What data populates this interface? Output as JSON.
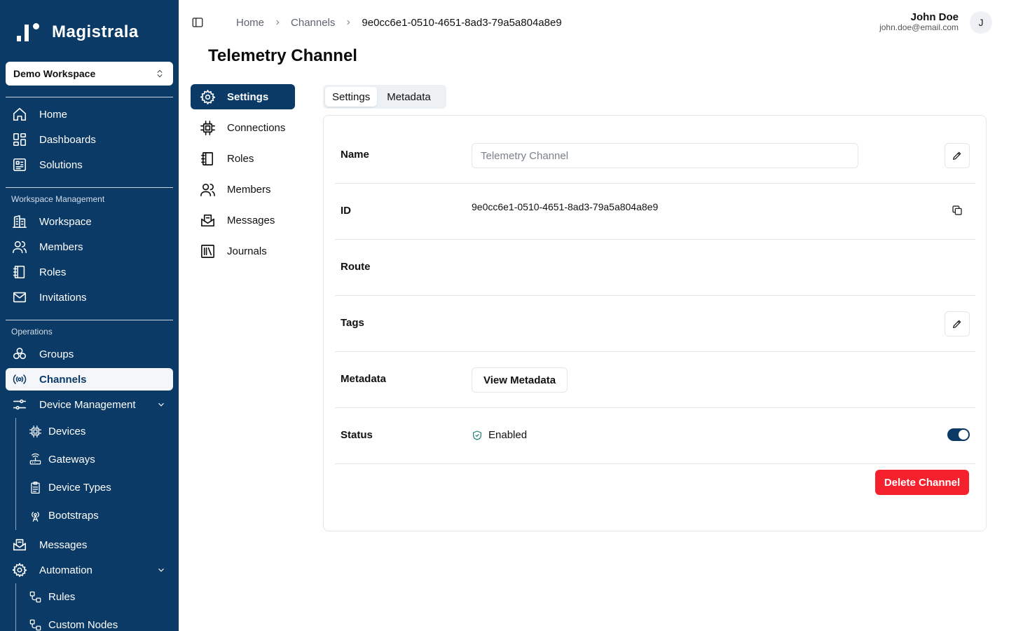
{
  "app": {
    "name": "Magistrala"
  },
  "workspace_select": {
    "value": "Demo Workspace"
  },
  "sidebar": {
    "top_items": [
      {
        "label": "Home",
        "icon": "home-icon"
      },
      {
        "label": "Dashboards",
        "icon": "dashboard-icon"
      },
      {
        "label": "Solutions",
        "icon": "solutions-icon"
      }
    ],
    "section_workspace": "Workspace Management",
    "workspace_items": [
      {
        "label": "Workspace",
        "icon": "building-icon"
      },
      {
        "label": "Members",
        "icon": "users-icon"
      },
      {
        "label": "Roles",
        "icon": "notebook-icon"
      },
      {
        "label": "Invitations",
        "icon": "mail-icon"
      }
    ],
    "section_operations": "Operations",
    "operations_items": [
      {
        "label": "Groups",
        "icon": "groups-icon"
      },
      {
        "label": "Channels",
        "icon": "broadcast-icon",
        "active": true
      },
      {
        "label": "Device Management",
        "icon": "sliders-icon"
      }
    ],
    "device_sub_items": [
      {
        "label": "Devices",
        "icon": "chip-icon"
      },
      {
        "label": "Gateways",
        "icon": "router-icon"
      },
      {
        "label": "Device Types",
        "icon": "clipboard-icon"
      },
      {
        "label": "Bootstraps",
        "icon": "antenna-icon"
      }
    ],
    "messages_item": {
      "label": "Messages",
      "icon": "mail-open-icon"
    },
    "automation_item": {
      "label": "Automation",
      "icon": "gear-icon"
    },
    "automation_sub_items": [
      {
        "label": "Rules",
        "icon": "workflow-icon"
      },
      {
        "label": "Custom Nodes",
        "icon": "workflow-icon"
      }
    ]
  },
  "breadcrumb": [
    "Home",
    "Channels",
    "9e0cc6e1-0510-4651-8ad3-79a5a804a8e9"
  ],
  "user": {
    "name": "John Doe",
    "email": "john.doe@email.com",
    "initial": "J"
  },
  "page": {
    "title": "Telemetry Channel"
  },
  "inner_nav": [
    {
      "label": "Settings",
      "icon": "gear-icon",
      "active": true
    },
    {
      "label": "Connections",
      "icon": "chip-icon"
    },
    {
      "label": "Roles",
      "icon": "notebook-icon"
    },
    {
      "label": "Members",
      "icon": "users-icon"
    },
    {
      "label": "Messages",
      "icon": "mail-open-icon"
    },
    {
      "label": "Journals",
      "icon": "library-icon"
    }
  ],
  "tabs": [
    {
      "label": "Settings",
      "active": true
    },
    {
      "label": "Metadata",
      "active": false
    }
  ],
  "fields": {
    "name_label": "Name",
    "name_value": "Telemetry Channel",
    "id_label": "ID",
    "id_value": "9e0cc6e1-0510-4651-8ad3-79a5a804a8e9",
    "route_label": "Route",
    "tags_label": "Tags",
    "metadata_label": "Metadata",
    "view_metadata_label": "View Metadata",
    "status_label": "Status",
    "status_value": "Enabled",
    "status_enabled": true
  },
  "actions": {
    "delete_label": "Delete Channel"
  },
  "colors": {
    "sidebar_bg": "#0b3a66",
    "danger": "#f5222d",
    "status_ok": "#1a7f78"
  }
}
